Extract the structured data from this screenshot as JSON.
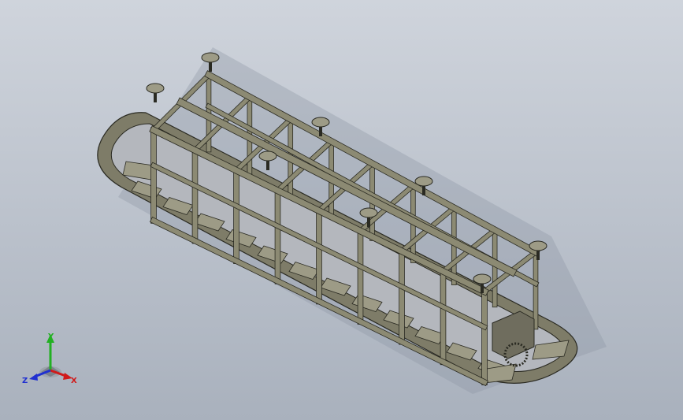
{
  "viewport": {
    "background_top": "#cfd4dc",
    "background_bottom": "#a9b1bd"
  },
  "model": {
    "frame_color": "#8c8a73",
    "frame_edge_color": "#2a2a22",
    "track_color": "#7e7c68",
    "plate_color": "#9d9b86",
    "motor_color": "#6f6d5e"
  },
  "triad": {
    "x_label": "X",
    "y_label": "Y",
    "z_label": "Z",
    "x_color": "#d01a1a",
    "y_color": "#22b022",
    "z_color": "#2030d0"
  }
}
